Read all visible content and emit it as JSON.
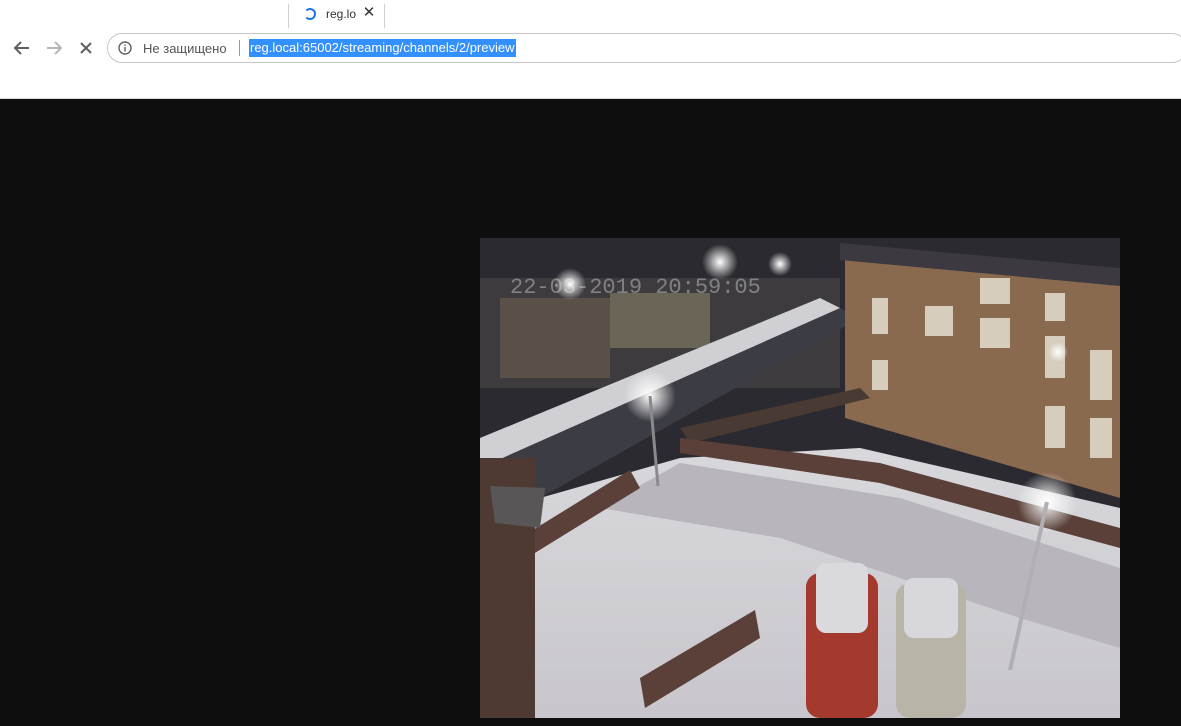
{
  "browser": {
    "tab": {
      "title": "reg.local",
      "loading_icon": "loading-spinner-icon",
      "close_icon": "close-icon"
    },
    "toolbar": {
      "back_icon": "arrow-back-icon",
      "forward_icon": "arrow-forward-icon",
      "stop_icon": "stop-icon",
      "security_icon": "info-icon",
      "security_label": "Не защищено",
      "url": "reg.local:65002/streaming/channels/2/preview"
    }
  },
  "content": {
    "background_color": "#0e0e0e",
    "video_preview": {
      "description_icon": "camera-feed-image",
      "osd_timestamp": "22-03-2019 20:59:05"
    }
  },
  "colors": {
    "accent": "#1a73e8",
    "selection": "#3390ff"
  }
}
